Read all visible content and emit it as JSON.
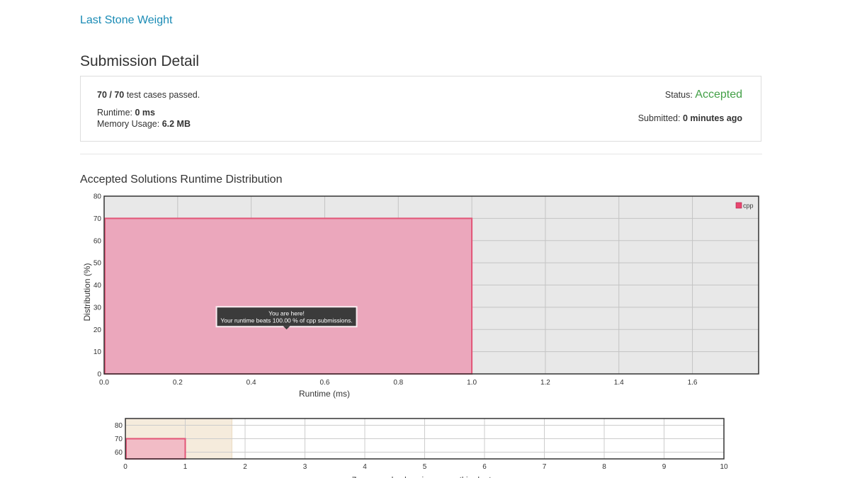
{
  "problem": {
    "title": "Last Stone Weight"
  },
  "page": {
    "title": "Submission Detail"
  },
  "submission": {
    "cases_count": "70 / 70",
    "cases_suffix": " test cases passed.",
    "runtime_label": "Runtime: ",
    "runtime_value": "0 ms",
    "memory_label": "Memory Usage: ",
    "memory_value": "6.2 MB",
    "status_label": "Status: ",
    "status_value": "Accepted",
    "submitted_label": "Submitted: ",
    "submitted_value": "0 minutes ago"
  },
  "distribution": {
    "title": "Accepted Solutions Runtime Distribution"
  },
  "colors": {
    "accepted": "#43a047",
    "link": "#1a8bb5",
    "bar_fill": "#eba7bc",
    "bar_stroke": "#e25577",
    "plot_bg": "#e8e8e8",
    "legend_swatch": "#e8466f",
    "selection": "#f5ebdc"
  },
  "chart_data": [
    {
      "type": "bar",
      "xlabel": "Runtime (ms)",
      "ylabel": "Distribution (%)",
      "xlim": [
        0,
        1.78
      ],
      "ylim": [
        0,
        80
      ],
      "xticks": [
        "0.0",
        "0.2",
        "0.4",
        "0.6",
        "0.8",
        "1.0",
        "1.2",
        "1.4",
        "1.6"
      ],
      "xtick_values": [
        0,
        0.2,
        0.4,
        0.6,
        0.8,
        1.0,
        1.2,
        1.4,
        1.6
      ],
      "yticks": [
        0,
        10,
        20,
        30,
        40,
        50,
        60,
        70,
        80
      ],
      "series": [
        {
          "name": "cpp",
          "bars": [
            {
              "x0": 0,
              "x1": 1.0,
              "value": 70
            }
          ]
        }
      ],
      "legend": {
        "placement": "top-right",
        "entries": [
          "cpp"
        ]
      },
      "annotation": {
        "line1": "You are here!",
        "line2": "Your runtime beats 100.00 % of cpp submissions.",
        "x": 0.5,
        "y": 20
      },
      "grid": true
    },
    {
      "type": "bar",
      "role": "navigator",
      "xlim": [
        0,
        10
      ],
      "ylim": [
        55,
        85
      ],
      "xticks": [
        "0",
        "1",
        "2",
        "3",
        "4",
        "5",
        "6",
        "7",
        "8",
        "9",
        "10"
      ],
      "xtick_values": [
        0,
        1,
        2,
        3,
        4,
        5,
        6,
        7,
        8,
        9,
        10
      ],
      "yticks": [
        60,
        70,
        80
      ],
      "bars": [
        {
          "x0": 0,
          "x1": 1,
          "value": 70
        }
      ],
      "selected_range": [
        0,
        1.78
      ],
      "hint": "Zoom area by dragging across this chart",
      "grid": true
    }
  ]
}
